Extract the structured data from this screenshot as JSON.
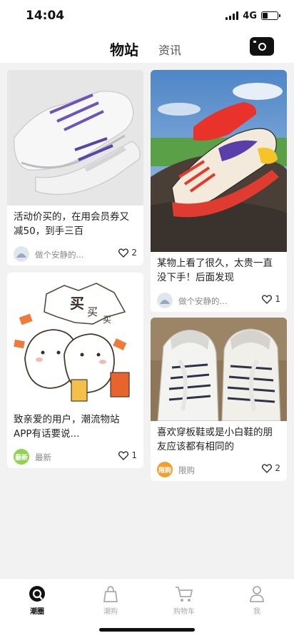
{
  "status_bar": {
    "time": "14:04",
    "network": "4G"
  },
  "header": {
    "active_tab": "物站",
    "inactive_tab": "资讯"
  },
  "posts": [
    {
      "title": "活动价买的，在用会员券又减50，到手三百",
      "author": "做个安静的...",
      "likes": "2"
    },
    {
      "title": "某物上看了很久，太贵一直没下手！后面发现",
      "author": "做个安静的...",
      "likes": "1"
    },
    {
      "title": "致亲爱的用户，潮流物站APP有话要说...",
      "author": "最新",
      "badge": "最新",
      "likes": "1"
    },
    {
      "title": "喜欢穿板鞋或是小白鞋的朋友应该都有相同的",
      "author": "限购",
      "badge": "限购",
      "likes": "2"
    }
  ],
  "poster_text": {
    "big": "买",
    "mid": "买",
    "small": "买"
  },
  "tabbar": [
    {
      "label": "潮圈",
      "icon": "chat-bubble-icon"
    },
    {
      "label": "潮购",
      "icon": "shopping-bag-icon"
    },
    {
      "label": "购物车",
      "icon": "cart-icon"
    },
    {
      "label": "我",
      "icon": "user-icon"
    }
  ],
  "colors": {
    "badge_new": "#8ed44f",
    "badge_limit": "#f0a030",
    "accent": "#111111"
  }
}
